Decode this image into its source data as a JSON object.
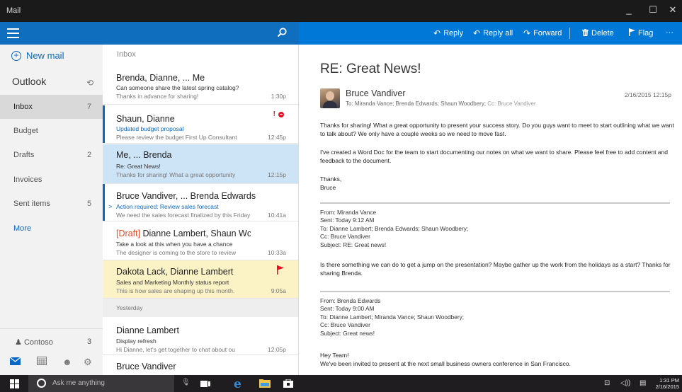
{
  "window": {
    "title": "Mail",
    "minimize": "_",
    "maximize": "☐",
    "close": "✕"
  },
  "commands": {
    "reply": "Reply",
    "reply_all": "Reply all",
    "forward": "Forward",
    "delete": "Delete",
    "flag": "Flag",
    "more": "···"
  },
  "nav": {
    "new_mail": "New mail",
    "account": "Outlook",
    "folders": [
      {
        "label": "Inbox",
        "count": "7"
      },
      {
        "label": "Budget",
        "count": ""
      },
      {
        "label": "Drafts",
        "count": "2"
      },
      {
        "label": "Invoices",
        "count": ""
      },
      {
        "label": "Sent items",
        "count": "5"
      }
    ],
    "more": "More",
    "other_account": {
      "label": "Contoso",
      "count": "3"
    }
  },
  "list": {
    "header": "Inbox",
    "day_header": "Yesterday",
    "messages": [
      {
        "from": "Brenda, Dianne, ... Me",
        "subject": "Can someone share the latest spring catalog?",
        "preview": "Thanks in advance for sharing!",
        "time": "1:30p"
      },
      {
        "from": "Shaun, Dianne",
        "subject": "Updated budget proposal",
        "preview": "Please review the budget First Up Consultant",
        "time": "12:45p",
        "importance": "!"
      },
      {
        "from": "Me, ... Brenda",
        "subject": "Re: Great News!",
        "preview": "Thanks for sharing! What a great opportunity",
        "time": "12:15p"
      },
      {
        "from": "Bruce Vandiver, ... Brenda Edwards",
        "subject": "Action required: Review sales forecast",
        "preview": "We need the sales forecast finalized by this Friday",
        "time": "10:41a",
        "chevron": ">"
      },
      {
        "draft": "[Draft]",
        "from": "Dianne Lambert, Shaun Wc",
        "subject": "Take a look at this when you have a chance",
        "preview": "The designer is coming to the store to review",
        "time": "10:33a"
      },
      {
        "from": "Dakota Lack, Dianne Lambert",
        "subject": "Sales and Marketing Monthly status report",
        "preview": "This is how sales are shaping up this month.",
        "time": "9:05a"
      },
      {
        "from": "Dianne Lambert",
        "subject": "Display refresh",
        "preview": "Hi Dianne, let's get together to chat about ou",
        "time": "12:05p"
      },
      {
        "from": "Bruce Vandiver"
      }
    ]
  },
  "reading": {
    "subject": "RE: Great News!",
    "sender": "Bruce Vandiver",
    "to": "To: Miranda Vance; Brenda Edwards; Shaun Woodbery;",
    "cc": "Cc: Bruce Vandiver",
    "date": "2/16/2015 12:15p",
    "para1": "Thanks for sharing! What a great opportunity to present your success story. Do you guys want to meet to start outlining what we want to talk about? We only have a couple weeks so we need to move fast.",
    "para2": "I've created a Word Doc for the team to start documenting our notes on what we want to share. Please feel free to add content and feedback to the document.",
    "signoff1": "Thanks,",
    "signoff2": "Bruce",
    "quote1": {
      "from": "From: Miranda Vance",
      "sent": "Sent: Today 9:12 AM",
      "to": "To: Dianne Lambert; Brenda Edwards; Shaun Woodbery;",
      "cc": "Cc: Bruce Vandiver",
      "subject": "Subject: RE: Great news!",
      "body": "Is there something we can do to get a jump on the presentation? Maybe gather up the work from the holidays as a start? Thanks for sharing Brenda."
    },
    "quote2": {
      "from": "From: Brenda Edwards",
      "sent": "Sent: Today 9:00 AM",
      "to": "To: Dianne Lambert; Miranda Vance; Shaun Woodbery;",
      "cc": "Cc: Bruce Vandiver",
      "subject": "Subject: Great news!",
      "greeting": "Hey Team!",
      "body": "We've been invited to present at the next small business owners conference in San Francisco."
    }
  },
  "taskbar": {
    "search_placeholder": "Ask me anything",
    "time": "1:31 PM",
    "date": "2/16/2015"
  },
  "colors": {
    "accent": "#0078d7",
    "accent_dark": "#106ebe",
    "flag": "#e81123",
    "draft": "#e8491d"
  }
}
